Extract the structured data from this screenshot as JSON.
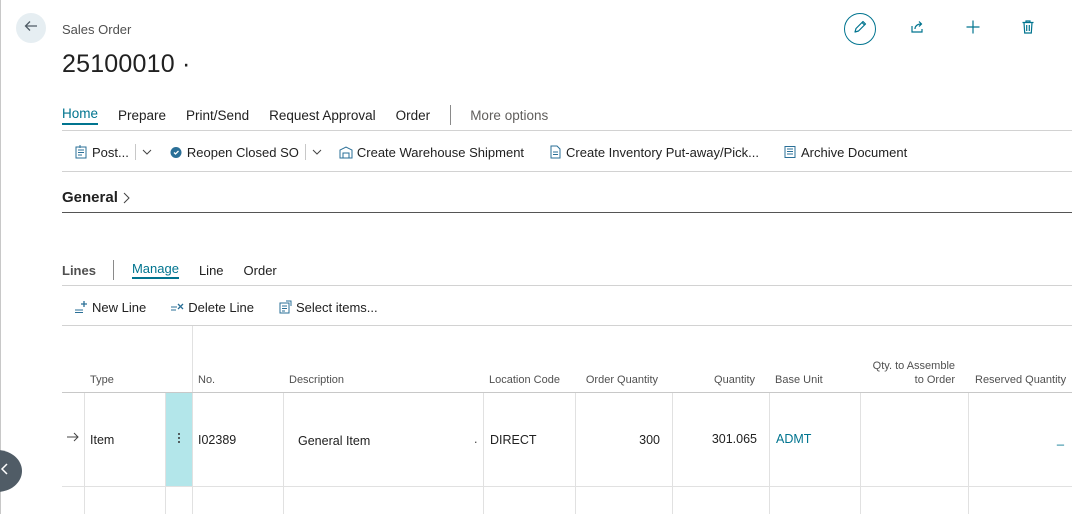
{
  "header": {
    "caption": "Sales Order",
    "record_no": "25100010 ·"
  },
  "menu": {
    "items": [
      "Home",
      "Prepare",
      "Print/Send",
      "Request Approval",
      "Order"
    ],
    "more": "More options"
  },
  "actions": {
    "post": "Post...",
    "reopen": "Reopen Closed SO",
    "create_shipment": "Create Warehouse Shipment",
    "create_putaway": "Create Inventory Put-away/Pick...",
    "archive": "Archive Document"
  },
  "general": {
    "title": "General"
  },
  "lines": {
    "title": "Lines",
    "tabs": [
      "Manage",
      "Line",
      "Order"
    ],
    "actions": [
      "New Line",
      "Delete Line",
      "Select items..."
    ],
    "columns": {
      "type": "Type",
      "no": "No.",
      "description": "Description",
      "location": "Location Code",
      "order_qty": "Order Quantity",
      "quantity": "Quantity",
      "base_unit": "Base Unit",
      "qty_assemble_line1": "Qty. to Assemble",
      "qty_assemble_line2": "to Order",
      "reserved": "Reserved Quantity"
    },
    "rows": [
      {
        "type": "Item",
        "no": "I02389",
        "description": "General Item",
        "location": "DIRECT",
        "order_qty": "300",
        "quantity": "301.065",
        "base_unit": "ADMT",
        "qty_assemble": "",
        "reserved": "_"
      }
    ]
  },
  "colors": {
    "accent": "#00748f",
    "drill_highlight": "#b3e6ea"
  },
  "icons": {
    "back": "arrow-left-icon",
    "edit": "pencil-icon",
    "share": "share-icon",
    "new": "plus-icon",
    "delete": "trash-icon"
  }
}
